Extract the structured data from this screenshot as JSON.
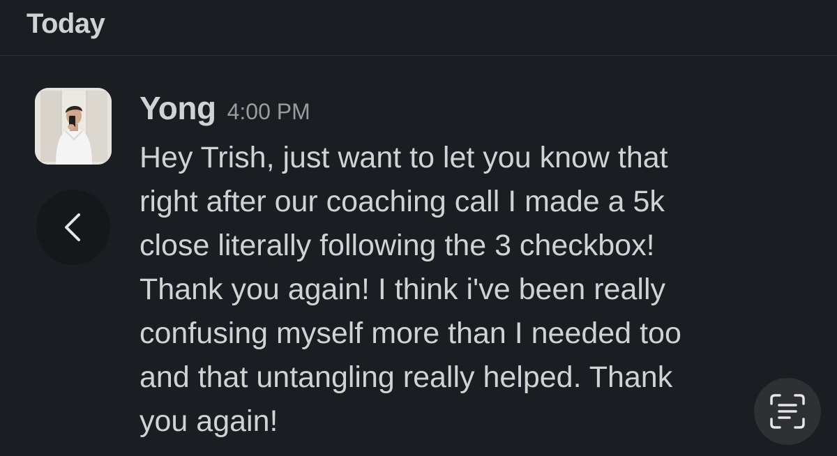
{
  "day_divider": {
    "label": "Today"
  },
  "message": {
    "sender": "Yong",
    "time": "4:00 PM",
    "lines": [
      "Hey Trish, just want to let you know that",
      "right after our coaching call I made a 5k",
      "close literally following the 3 checkbox!",
      "Thank you again! I think i've been really",
      "confusing myself more than I needed too",
      "and that untangling really helped. Thank",
      "you again!"
    ]
  },
  "icons": {
    "back": "chevron-left-icon",
    "text_scan": "live-text-icon",
    "avatar": "user-avatar-photo"
  },
  "colors": {
    "background": "#1a1d21",
    "text": "#d1d2d3",
    "timestamp": "#9a9b9d"
  }
}
